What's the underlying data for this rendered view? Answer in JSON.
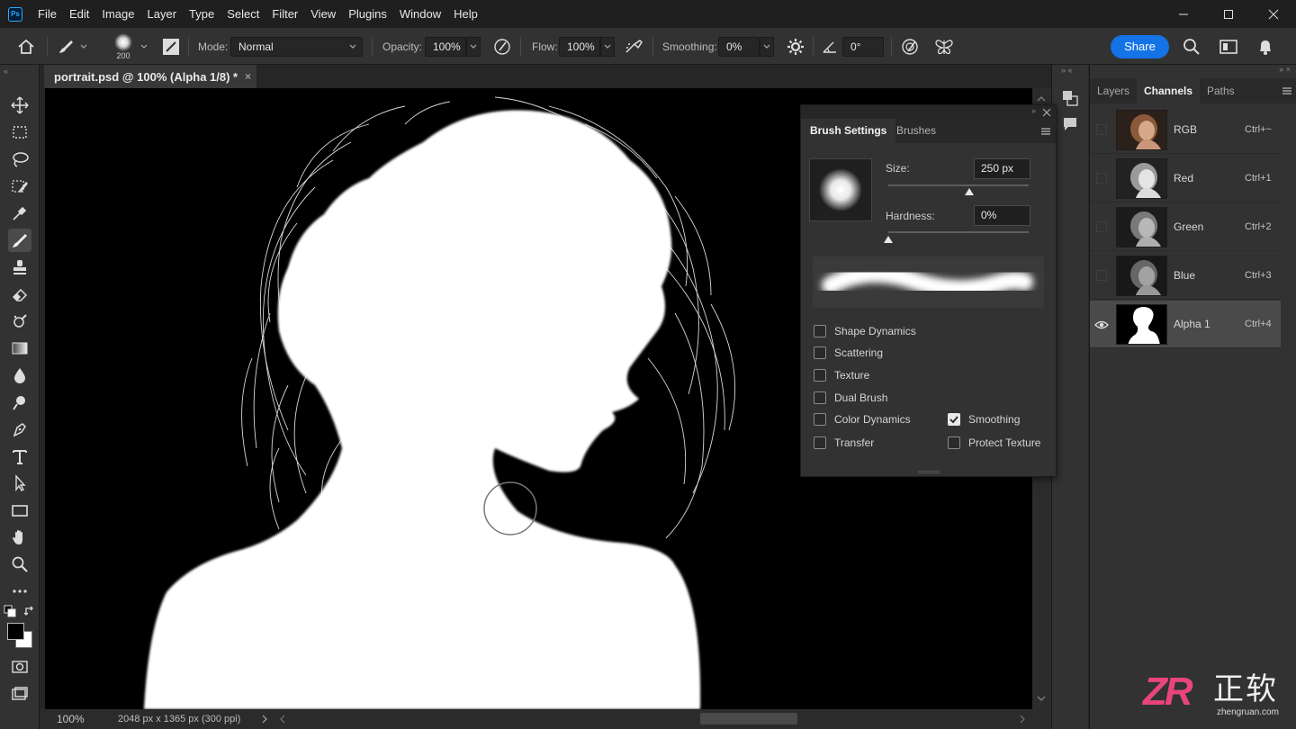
{
  "app": {
    "logo_text": "Ps",
    "menu": [
      "File",
      "Edit",
      "Image",
      "Layer",
      "Type",
      "Select",
      "Filter",
      "View",
      "Plugins",
      "Window",
      "Help"
    ]
  },
  "options_bar": {
    "brush_size": "200",
    "mode_label": "Mode:",
    "mode_value": "Normal",
    "opacity_label": "Opacity:",
    "opacity_value": "100%",
    "flow_label": "Flow:",
    "flow_value": "100%",
    "smoothing_label": "Smoothing:",
    "smoothing_value": "0%",
    "angle_value": "0°",
    "share_label": "Share"
  },
  "document": {
    "tab_title": "portrait.psd @ 100% (Alpha 1/8) *",
    "tab_close": "×",
    "zoom": "100%",
    "doc_info": "2048 px x 1365 px (300 ppi)"
  },
  "brush_settings": {
    "tabs": [
      "Brush Settings",
      "Brushes"
    ],
    "size_label": "Size:",
    "size_value": "250 px",
    "size_fraction": 0.58,
    "hardness_label": "Hardness:",
    "hardness_value": "0%",
    "hardness_fraction": 0.0,
    "options": [
      {
        "label": "Shape Dynamics",
        "checked": false
      },
      {
        "label": "Scattering",
        "checked": false
      },
      {
        "label": "Texture",
        "checked": false
      },
      {
        "label": "Dual Brush",
        "checked": false
      },
      {
        "label": "Color Dynamics",
        "checked": false
      },
      {
        "label": "Transfer",
        "checked": false
      },
      {
        "label": "Smoothing",
        "checked": true
      },
      {
        "label": "Protect Texture",
        "checked": false
      }
    ]
  },
  "channels_panel": {
    "tabs": [
      "Layers",
      "Channels",
      "Paths"
    ],
    "active_tab": "Channels",
    "channels": [
      {
        "name": "RGB",
        "shortcut": "Ctrl+~",
        "visible": false,
        "selected": false
      },
      {
        "name": "Red",
        "shortcut": "Ctrl+1",
        "visible": false,
        "selected": false
      },
      {
        "name": "Green",
        "shortcut": "Ctrl+2",
        "visible": false,
        "selected": false
      },
      {
        "name": "Blue",
        "shortcut": "Ctrl+3",
        "visible": false,
        "selected": false
      },
      {
        "name": "Alpha 1",
        "shortcut": "Ctrl+4",
        "visible": true,
        "selected": true
      }
    ]
  },
  "watermark": {
    "logo": "ZR",
    "chinese": "正软",
    "domain": "zhengruan.com"
  },
  "colors": {
    "accent": "#1473e6",
    "foreground": "#000000",
    "background": "#ffffff"
  }
}
